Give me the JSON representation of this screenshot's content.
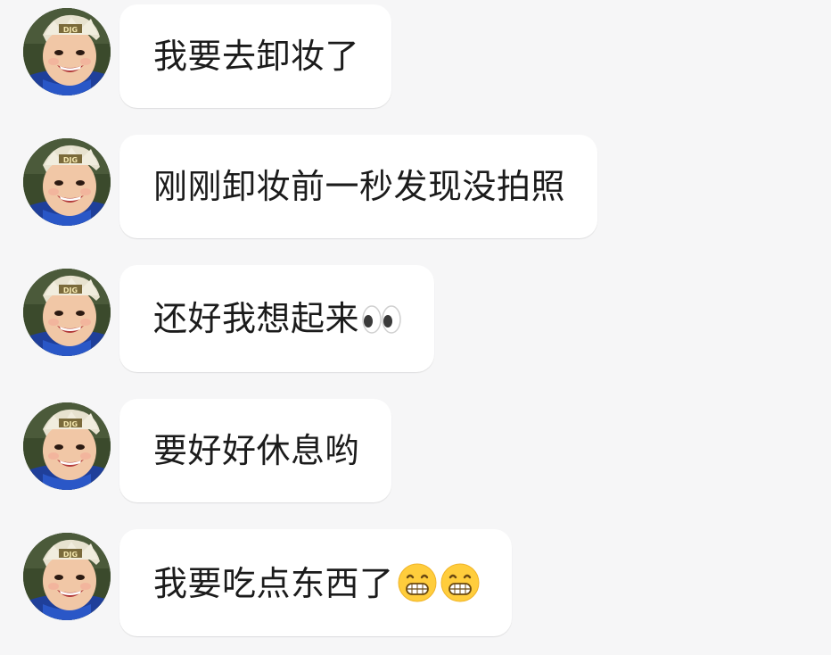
{
  "colors": {
    "background": "#f6f6f7",
    "bubble": "#ffffff",
    "text": "#1b1b1b",
    "emoji_face": "#ffcd3c"
  },
  "messages": [
    {
      "text": "我要去卸妆了",
      "emojis": []
    },
    {
      "text": "刚刚卸妆前一秒发现没拍照",
      "emojis": []
    },
    {
      "text": "还好我想起来",
      "emojis": [
        "eyes-emoji"
      ]
    },
    {
      "text": "要好好休息哟",
      "emojis": []
    },
    {
      "text": "我要吃点东西了",
      "emojis": [
        "grinning-face-emoji",
        "grinning-face-emoji"
      ]
    }
  ],
  "avatar": {
    "icon": "child-avatar-photo"
  }
}
